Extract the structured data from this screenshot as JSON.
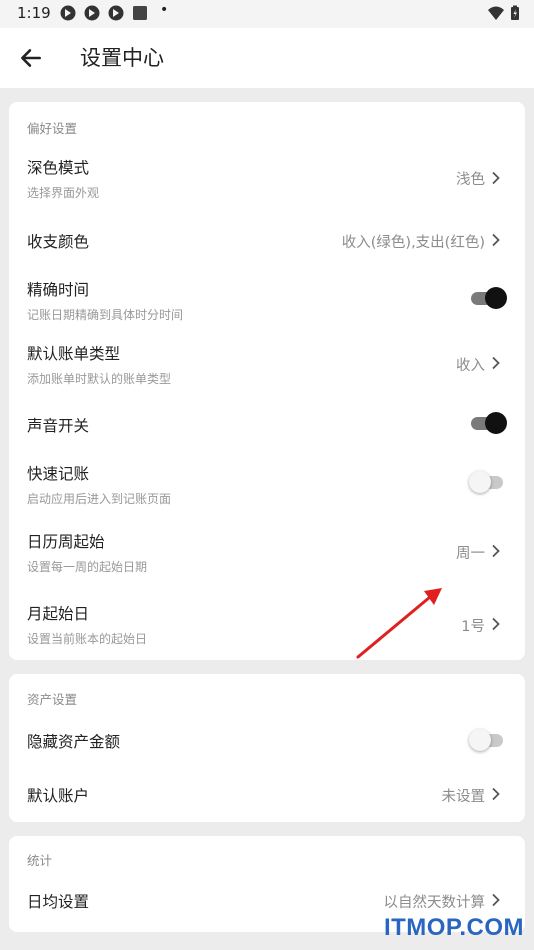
{
  "status_bar": {
    "time": "1:19",
    "dot": "•"
  },
  "header": {
    "title": "设置中心"
  },
  "sections": {
    "preferences": {
      "title": "偏好设置",
      "dark_mode": {
        "label": "深色模式",
        "sub": "选择界面外观",
        "value": "浅色"
      },
      "income_color": {
        "label": "收支颜色",
        "value": "收入(绿色),支出(红色)"
      },
      "precise_time": {
        "label": "精确时间",
        "sub": "记账日期精确到具体时分时间",
        "enabled": true
      },
      "default_bill_type": {
        "label": "默认账单类型",
        "sub": "添加账单时默认的账单类型",
        "value": "收入"
      },
      "sound": {
        "label": "声音开关",
        "enabled": true
      },
      "quick_entry": {
        "label": "快速记账",
        "sub": "启动应用后进入到记账页面",
        "enabled": false
      },
      "week_start": {
        "label": "日历周起始",
        "sub": "设置每一周的起始日期",
        "value": "周一"
      },
      "month_start": {
        "label": "月起始日",
        "sub": "设置当前账本的起始日",
        "value": "1号"
      }
    },
    "assets": {
      "title": "资产设置",
      "hide_amount": {
        "label": "隐藏资产金额",
        "enabled": false
      },
      "default_account": {
        "label": "默认账户",
        "value": "未设置"
      }
    },
    "stats": {
      "title": "统计",
      "daily_avg": {
        "label": "日均设置",
        "value": "以自然天数计算"
      }
    }
  },
  "watermark": "ITMOP.COM",
  "colors": {
    "background": "#ececec",
    "card": "#ffffff",
    "toggle_on": "#111111",
    "toggle_off": "#f5f5f5",
    "annotation_arrow": "#e02020",
    "watermark": "#2a66c0"
  }
}
